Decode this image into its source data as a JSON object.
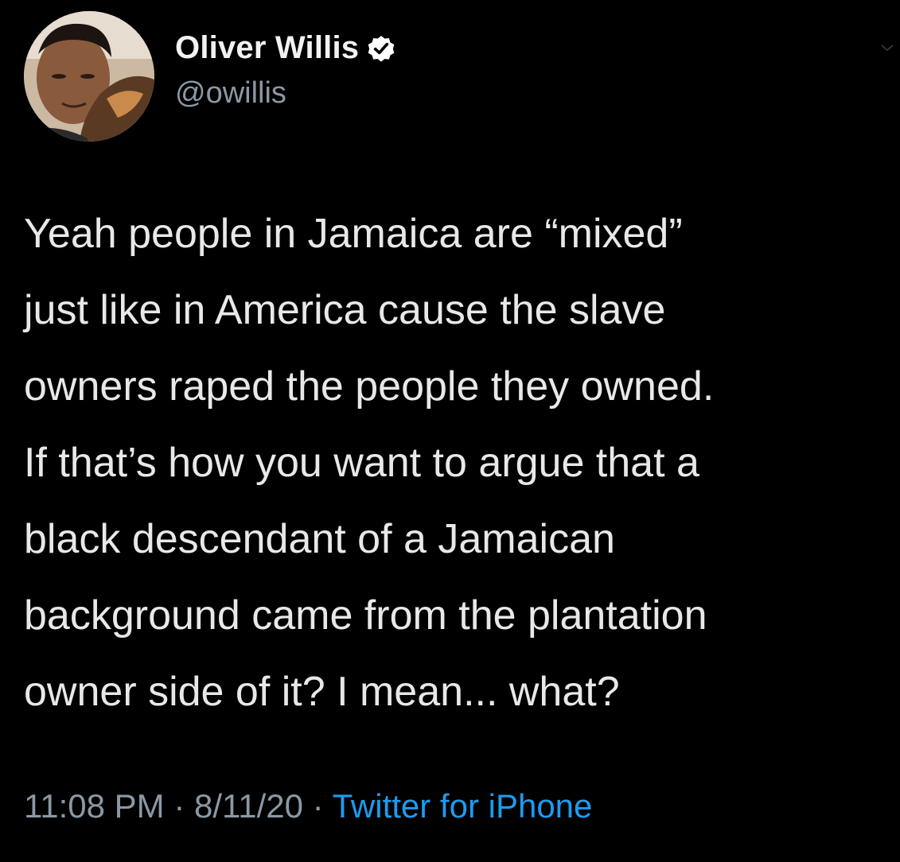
{
  "author": {
    "display_name": "Oliver Willis",
    "handle": "@owillis",
    "verified_icon": "verified-badge-icon",
    "avatar_icon": "avatar-photo"
  },
  "tweet": {
    "text": "Yeah people in Jamaica are “mixed”\njust like in America cause the slave\nowners raped the people they owned.\nIf that’s how you want to argue that a\nblack descendant of a Jamaican\nbackground came from the plantation\nowner side of it? I mean... what?"
  },
  "meta": {
    "time": "11:08 PM",
    "separator": " · ",
    "date": "8/11/20",
    "source": "Twitter for iPhone"
  },
  "colors": {
    "background": "#000000",
    "text": "#e8e8e8",
    "muted": "#8b98a5",
    "link": "#1d9bf0"
  }
}
